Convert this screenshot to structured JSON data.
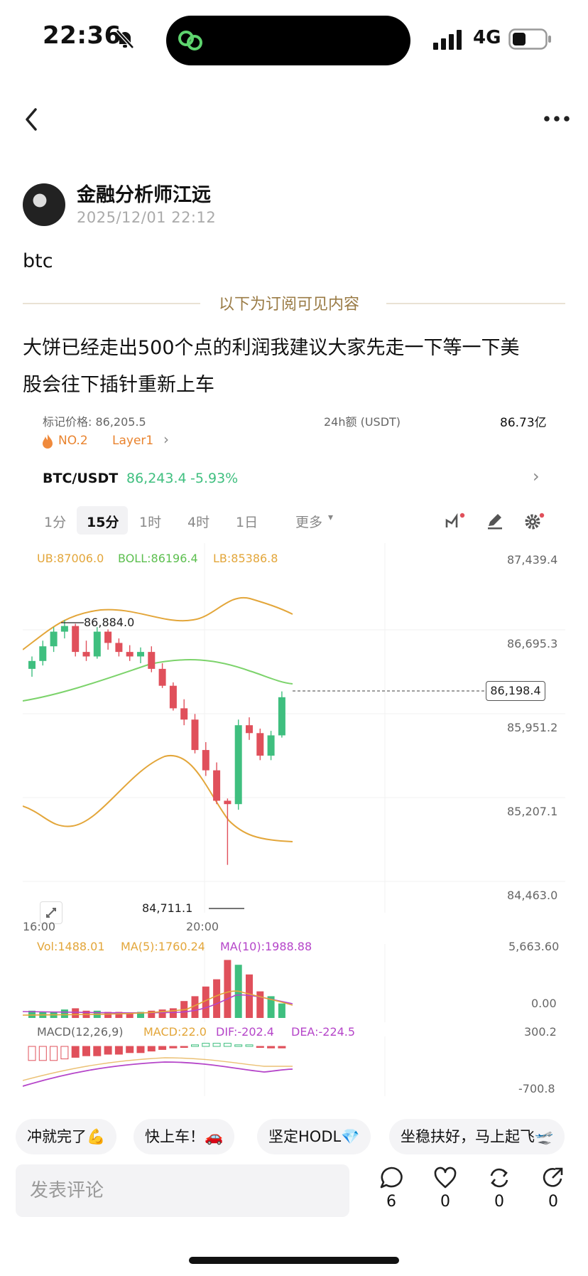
{
  "status_bar": {
    "time": "22:36",
    "network": "4G"
  },
  "author": {
    "name": "金融分析师江远",
    "date": "2025/12/01 22:12"
  },
  "post": {
    "text": "btc",
    "divider": "以下为订阅可见内容",
    "body_line1": "大饼已经走出500个点的利润我建议大家先走一下等一下美",
    "body_line2": "股会往下插针重新上车"
  },
  "chart_card": {
    "top_cut_left": "标记价格: 86,205.5",
    "top_cut_right_label": "24h额 (USDT)",
    "top_cut_right_value": "86.73亿",
    "rank": "NO.2",
    "tag": "Layer1",
    "pair": "BTC/USDT",
    "price": "86,243.4",
    "change": "-5.93%",
    "tabs": [
      "1分",
      "15分",
      "1时",
      "4时",
      "1日",
      "更多"
    ],
    "active_tab": "15分",
    "boll": {
      "ub": "UB:87006.0",
      "boll": "BOLL:86196.4",
      "lb": "LB:85386.8"
    },
    "price_axis": [
      "87,439.4",
      "86,695.3",
      "85,951.2",
      "85,207.1",
      "84,463.0"
    ],
    "current_price_tag": "86,198.4",
    "high_label": "86,884.0",
    "low_label": "84,711.1",
    "time_axis": [
      "16:00",
      "20:00"
    ],
    "vol": {
      "vol": "Vol:1488.01",
      "ma5": "MA(5):1760.24",
      "ma10": "MA(10):1988.88",
      "top": "5,663.60",
      "bottom": "0.00"
    },
    "macd": {
      "label": "MACD(12,26,9)",
      "macd": "MACD:22.0",
      "dif": "DIF:-202.4",
      "dea": "DEA:-224.5",
      "top": "300.2",
      "bottom": "-700.8"
    },
    "colors": {
      "up": "#3fbf7f",
      "down": "#e0505b",
      "boll_mid": "#7cd36b",
      "boll_band": "#e3a63a",
      "ma10": "#b545c9"
    }
  },
  "chart_data": {
    "type": "candlestick",
    "series": [
      {
        "open": 86450,
        "high": 86560,
        "low": 86380,
        "close": 86520
      },
      {
        "open": 86520,
        "high": 86700,
        "low": 86480,
        "close": 86650
      },
      {
        "open": 86650,
        "high": 86820,
        "low": 86600,
        "close": 86780
      },
      {
        "open": 86780,
        "high": 86884,
        "low": 86720,
        "close": 86830
      },
      {
        "open": 86830,
        "high": 86850,
        "low": 86560,
        "close": 86600
      },
      {
        "open": 86600,
        "high": 86700,
        "low": 86520,
        "close": 86560
      },
      {
        "open": 86560,
        "high": 86820,
        "low": 86540,
        "close": 86780
      },
      {
        "open": 86780,
        "high": 86800,
        "low": 86620,
        "close": 86680
      },
      {
        "open": 86680,
        "high": 86720,
        "low": 86560,
        "close": 86600
      },
      {
        "open": 86600,
        "high": 86660,
        "low": 86520,
        "close": 86560
      },
      {
        "open": 86560,
        "high": 86640,
        "low": 86500,
        "close": 86600
      },
      {
        "open": 86600,
        "high": 86650,
        "low": 86420,
        "close": 86450
      },
      {
        "open": 86450,
        "high": 86500,
        "low": 86280,
        "close": 86300
      },
      {
        "open": 86300,
        "high": 86330,
        "low": 86080,
        "close": 86100
      },
      {
        "open": 86100,
        "high": 86180,
        "low": 85950,
        "close": 86000
      },
      {
        "open": 86000,
        "high": 86050,
        "low": 85700,
        "close": 85730
      },
      {
        "open": 85730,
        "high": 85800,
        "low": 85500,
        "close": 85550
      },
      {
        "open": 85550,
        "high": 85620,
        "low": 85250,
        "close": 85280
      },
      {
        "open": 85280,
        "high": 85300,
        "low": 84711.1,
        "close": 85250
      },
      {
        "open": 85250,
        "high": 86000,
        "low": 85200,
        "close": 85950
      },
      {
        "open": 85950,
        "high": 86020,
        "low": 85820,
        "close": 85880
      },
      {
        "open": 85880,
        "high": 85920,
        "low": 85640,
        "close": 85680
      },
      {
        "open": 85680,
        "high": 85900,
        "low": 85640,
        "close": 85860
      },
      {
        "open": 85860,
        "high": 86250,
        "low": 85840,
        "close": 86198.4
      }
    ],
    "ylim": [
      84463.0,
      87439.4
    ]
  },
  "reactions": [
    "冲就完了💪",
    "快上车！🚗",
    "坚定HODL💎",
    "坐稳扶好，马上起飞🛫"
  ],
  "comment": {
    "placeholder": "发表评论"
  },
  "actions": {
    "comments": "6",
    "likes": "0",
    "reposts": "0",
    "shares": "0"
  }
}
